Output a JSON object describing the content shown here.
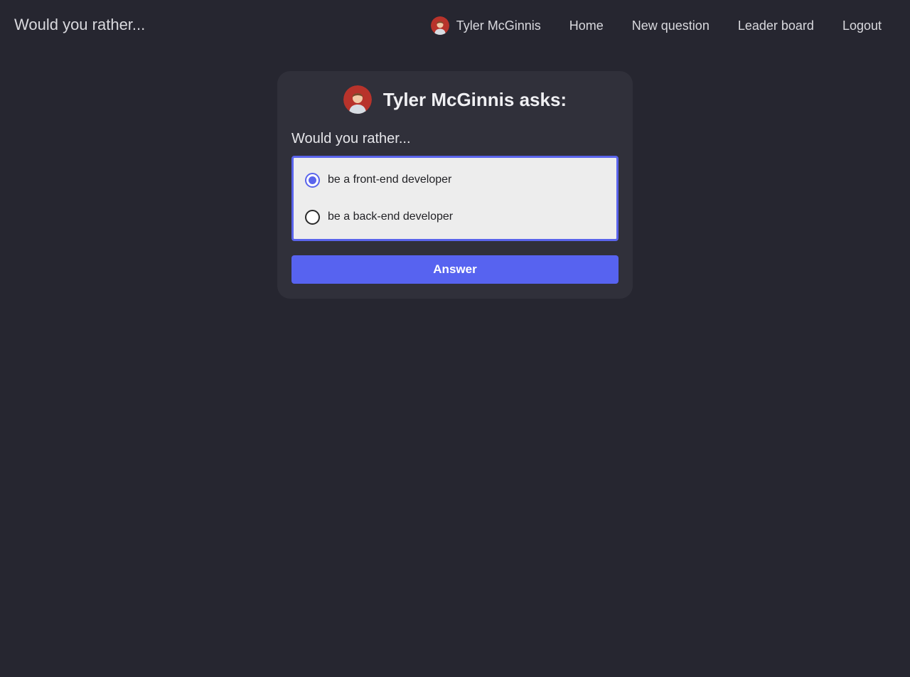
{
  "navbar": {
    "brand": "Would you rather...",
    "user_name": "Tyler McGinnis",
    "user_avatar_icon": "user-avatar-icon",
    "links": [
      "Home",
      "New question",
      "Leader board",
      "Logout"
    ]
  },
  "poll": {
    "author_heading": "Tyler McGinnis asks:",
    "author_avatar_icon": "user-avatar-icon",
    "question": "Would you rather...",
    "options": [
      {
        "label": "be a front-end developer",
        "selected": true
      },
      {
        "label": "be a back-end developer",
        "selected": false
      }
    ],
    "submit_label": "Answer"
  },
  "colors": {
    "background": "#262630",
    "card": "#30303a",
    "accent": "#5763f0",
    "avatar_bg": "#b8332b"
  }
}
